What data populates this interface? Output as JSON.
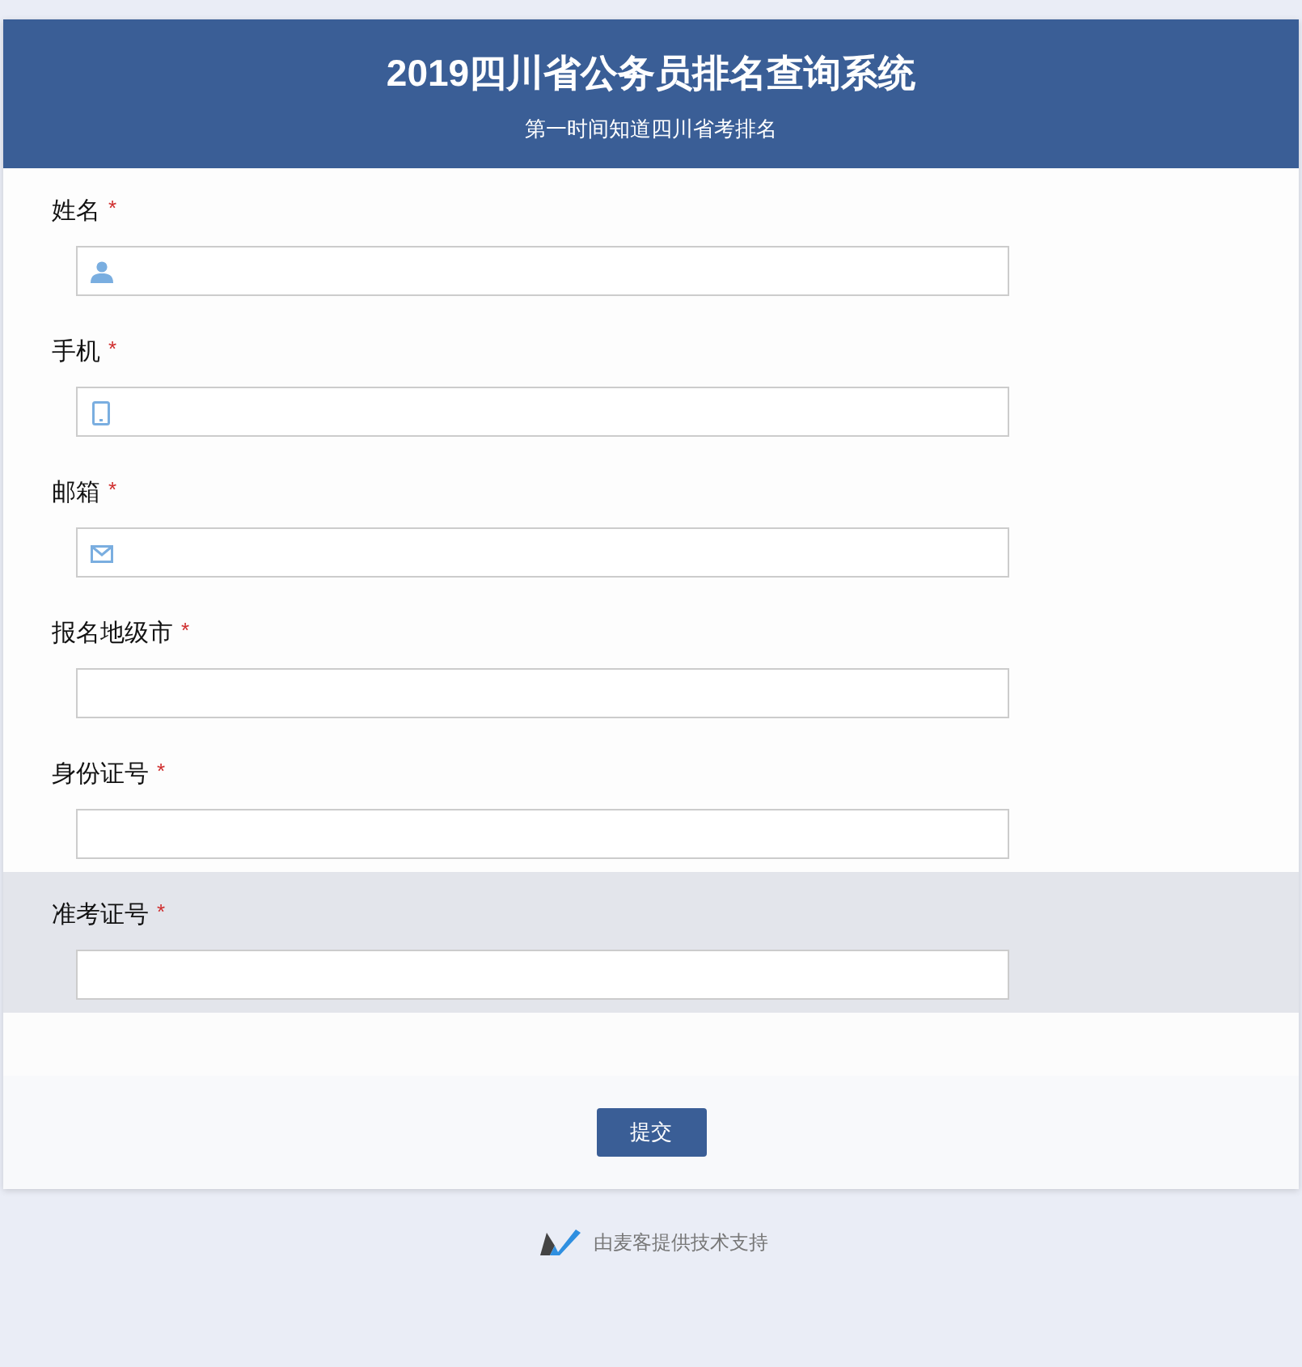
{
  "header": {
    "title": "2019四川省公务员排名查询系统",
    "subtitle": "第一时间知道四川省考排名"
  },
  "fields": [
    {
      "label": "姓名",
      "required_mark": "*",
      "kind": "person",
      "highlighted": false
    },
    {
      "label": "手机",
      "required_mark": "*",
      "kind": "phone",
      "highlighted": false
    },
    {
      "label": "邮箱",
      "required_mark": "*",
      "kind": "mail",
      "highlighted": false
    },
    {
      "label": "报名地级市",
      "required_mark": "*",
      "highlighted": false
    },
    {
      "label": "身份证号",
      "required_mark": "*",
      "highlighted": false
    },
    {
      "label": "准考证号",
      "required_mark": "*",
      "highlighted": true
    }
  ],
  "submit": "提交",
  "footer": {
    "text": "由麦客提供技术支持"
  }
}
